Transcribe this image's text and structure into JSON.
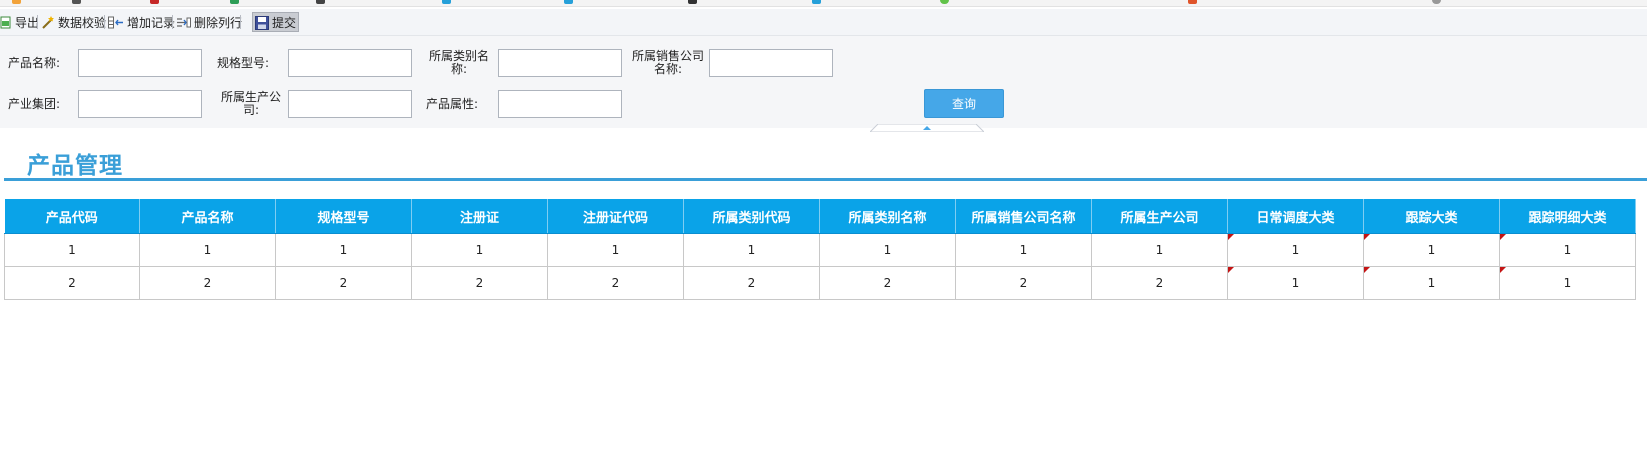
{
  "toolbar": {
    "export_label": "导出",
    "validate_label": "数据校验",
    "add_label": "增加记录",
    "delete_label": "删除列行",
    "submit_label": "提交"
  },
  "filters": {
    "product_name_label": "产品名称:",
    "spec_model_label": "规格型号:",
    "category_name_label_1": "所属类别名",
    "category_name_label_2": "称:",
    "sales_company_label_1": "所属销售公司",
    "sales_company_label_2": "名称:",
    "industry_group_label": "产业集团:",
    "mfr_company_label_1": "所属生产公",
    "mfr_company_label_2": "司:",
    "product_attr_label": "产品属性:",
    "query_label": "查询",
    "values": {
      "product_name": "",
      "spec_model": "",
      "category_name": "",
      "sales_company": "",
      "industry_group": "",
      "mfr_company": "",
      "product_attr": ""
    }
  },
  "page": {
    "title": "产品管理"
  },
  "table": {
    "columns": [
      "产品代码",
      "产品名称",
      "规格型号",
      "注册证",
      "注册证代码",
      "所属类别代码",
      "所属类别名称",
      "所属销售公司名称",
      "所属生产公司",
      "日常调度大类",
      "跟踪大类",
      "跟踪明细大类"
    ],
    "rows": [
      [
        "1",
        "1",
        "1",
        "1",
        "1",
        "1",
        "1",
        "1",
        "1",
        "1",
        "1",
        "1"
      ],
      [
        "2",
        "2",
        "2",
        "2",
        "2",
        "2",
        "2",
        "2",
        "2",
        "1",
        "1",
        "1"
      ]
    ]
  },
  "colors": {
    "accent": "#3a9fd8",
    "header_bg": "#0aa3e8",
    "button_bg": "#45a7e8",
    "flag": "#c41414"
  }
}
